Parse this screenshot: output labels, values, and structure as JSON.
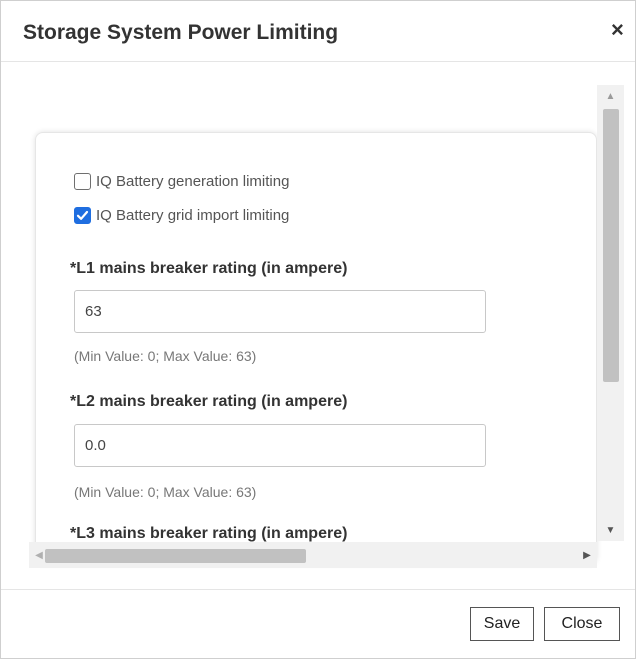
{
  "dialog": {
    "title": "Storage System Power Limiting",
    "close_symbol": "×"
  },
  "checkboxes": [
    {
      "label": "IQ Battery generation limiting",
      "checked": false
    },
    {
      "label": "IQ Battery grid import limiting",
      "checked": true
    }
  ],
  "fields": [
    {
      "label": "*L1 mains breaker rating (in ampere)",
      "value": "63",
      "hint": "(Min Value: 0; Max Value: 63)"
    },
    {
      "label": "*L2 mains breaker rating (in ampere)",
      "value": "0.0",
      "hint": "(Min Value: 0; Max Value: 63)"
    },
    {
      "label": "*L3 mains breaker rating (in ampere)"
    }
  ],
  "footer": {
    "save_label": "Save",
    "close_label": "Close"
  },
  "colors": {
    "checkbox_accent": "#1f6ee0"
  },
  "icons": {
    "close": "close-icon",
    "checked": "checkmark-icon",
    "scroll_up": "triangle-up",
    "scroll_down": "triangle-down",
    "scroll_left": "triangle-left",
    "scroll_right": "triangle-right"
  }
}
